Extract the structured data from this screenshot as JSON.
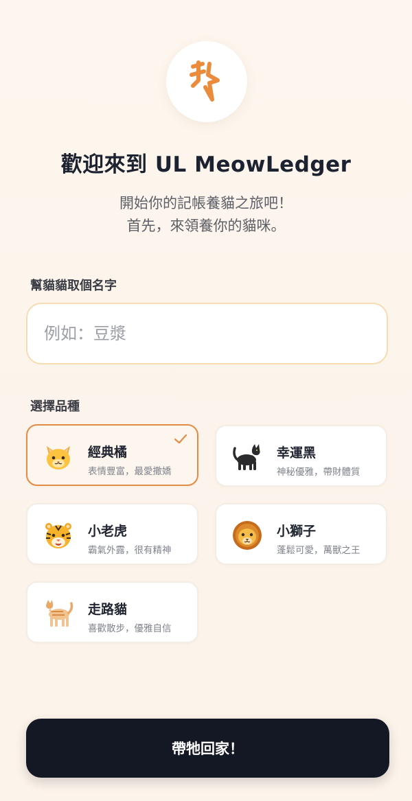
{
  "header": {
    "logo_icon": "brand-mark-icon",
    "title": "歡迎來到 UL MeowLedger",
    "subtitle_line1": "開始你的記帳養貓之旅吧！",
    "subtitle_line2": "首先，來領養你的貓咪。"
  },
  "name_section": {
    "label": "幫貓貓取個名字",
    "input_value": "",
    "placeholder": "例如：豆漿"
  },
  "breed_section": {
    "label": "選擇品種",
    "selected_index": 0,
    "breeds": [
      {
        "name": "經典橘",
        "desc": "表情豐富，最愛撒嬌",
        "icon": "cat-face-icon",
        "selected": true
      },
      {
        "name": "幸運黑",
        "desc": "神秘優雅，帶財體質",
        "icon": "black-cat-icon",
        "selected": false
      },
      {
        "name": "小老虎",
        "desc": "霸氣外露，很有精神",
        "icon": "tiger-face-icon",
        "selected": false
      },
      {
        "name": "小獅子",
        "desc": "蓬鬆可愛，萬獸之王",
        "icon": "lion-face-icon",
        "selected": false
      },
      {
        "name": "走路貓",
        "desc": "喜歡散步，優雅自信",
        "icon": "walking-cat-icon",
        "selected": false
      }
    ]
  },
  "cta": {
    "label": "帶牠回家！"
  },
  "colors": {
    "accent": "#e58a44",
    "background": "#fdf6ee",
    "button": "#141824"
  }
}
